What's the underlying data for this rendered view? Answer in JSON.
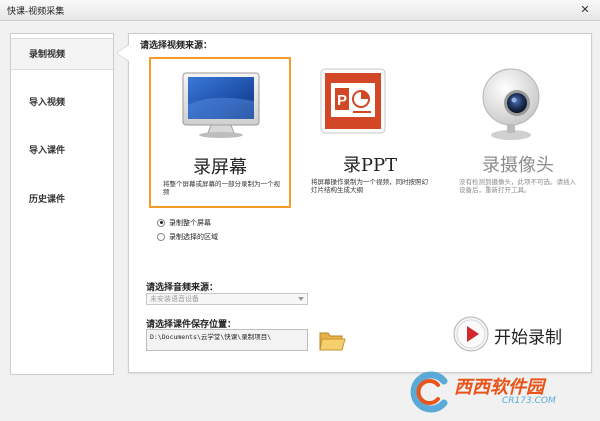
{
  "window": {
    "title": "快课-视频采集",
    "close_glyph": "✕"
  },
  "sidebar": {
    "items": [
      {
        "label": "录制视频",
        "active": true
      },
      {
        "label": "导入视频"
      },
      {
        "label": "导入课件"
      },
      {
        "label": "历史课件"
      }
    ]
  },
  "main": {
    "source_label": "请选择视频来源：",
    "sources": [
      {
        "name": "录屏幕",
        "desc": "将整个屏幕或屏幕的一部分录制为一个视频",
        "icon": "monitor-icon",
        "selected": true
      },
      {
        "name": "录PPT",
        "desc": "将屏幕操作录制为一个视频，同时按照幻灯片结构生成大纲",
        "icon": "powerpoint-icon"
      },
      {
        "name": "录摄像头",
        "desc": "没有检测到摄像头，此项不可选。请插入设备后，重新打开工具。",
        "icon": "webcam-icon",
        "disabled": true
      }
    ],
    "capture_options": [
      {
        "label": "录制整个屏幕",
        "checked": true
      },
      {
        "label": "录制选择的区域",
        "checked": false
      }
    ],
    "audio_label": "请选择音频来源：",
    "audio_value": "未安装语音设备",
    "save_label": "请选择课件保存位置：",
    "save_path": "D:\\Documents\\云学堂\\快课\\录制项目\\",
    "start_label": "开始录制"
  },
  "watermark": {
    "text": "西西软件园",
    "url": "CR173.COM"
  },
  "colors": {
    "accent": "#f49b2a",
    "record": "#d0282b"
  }
}
